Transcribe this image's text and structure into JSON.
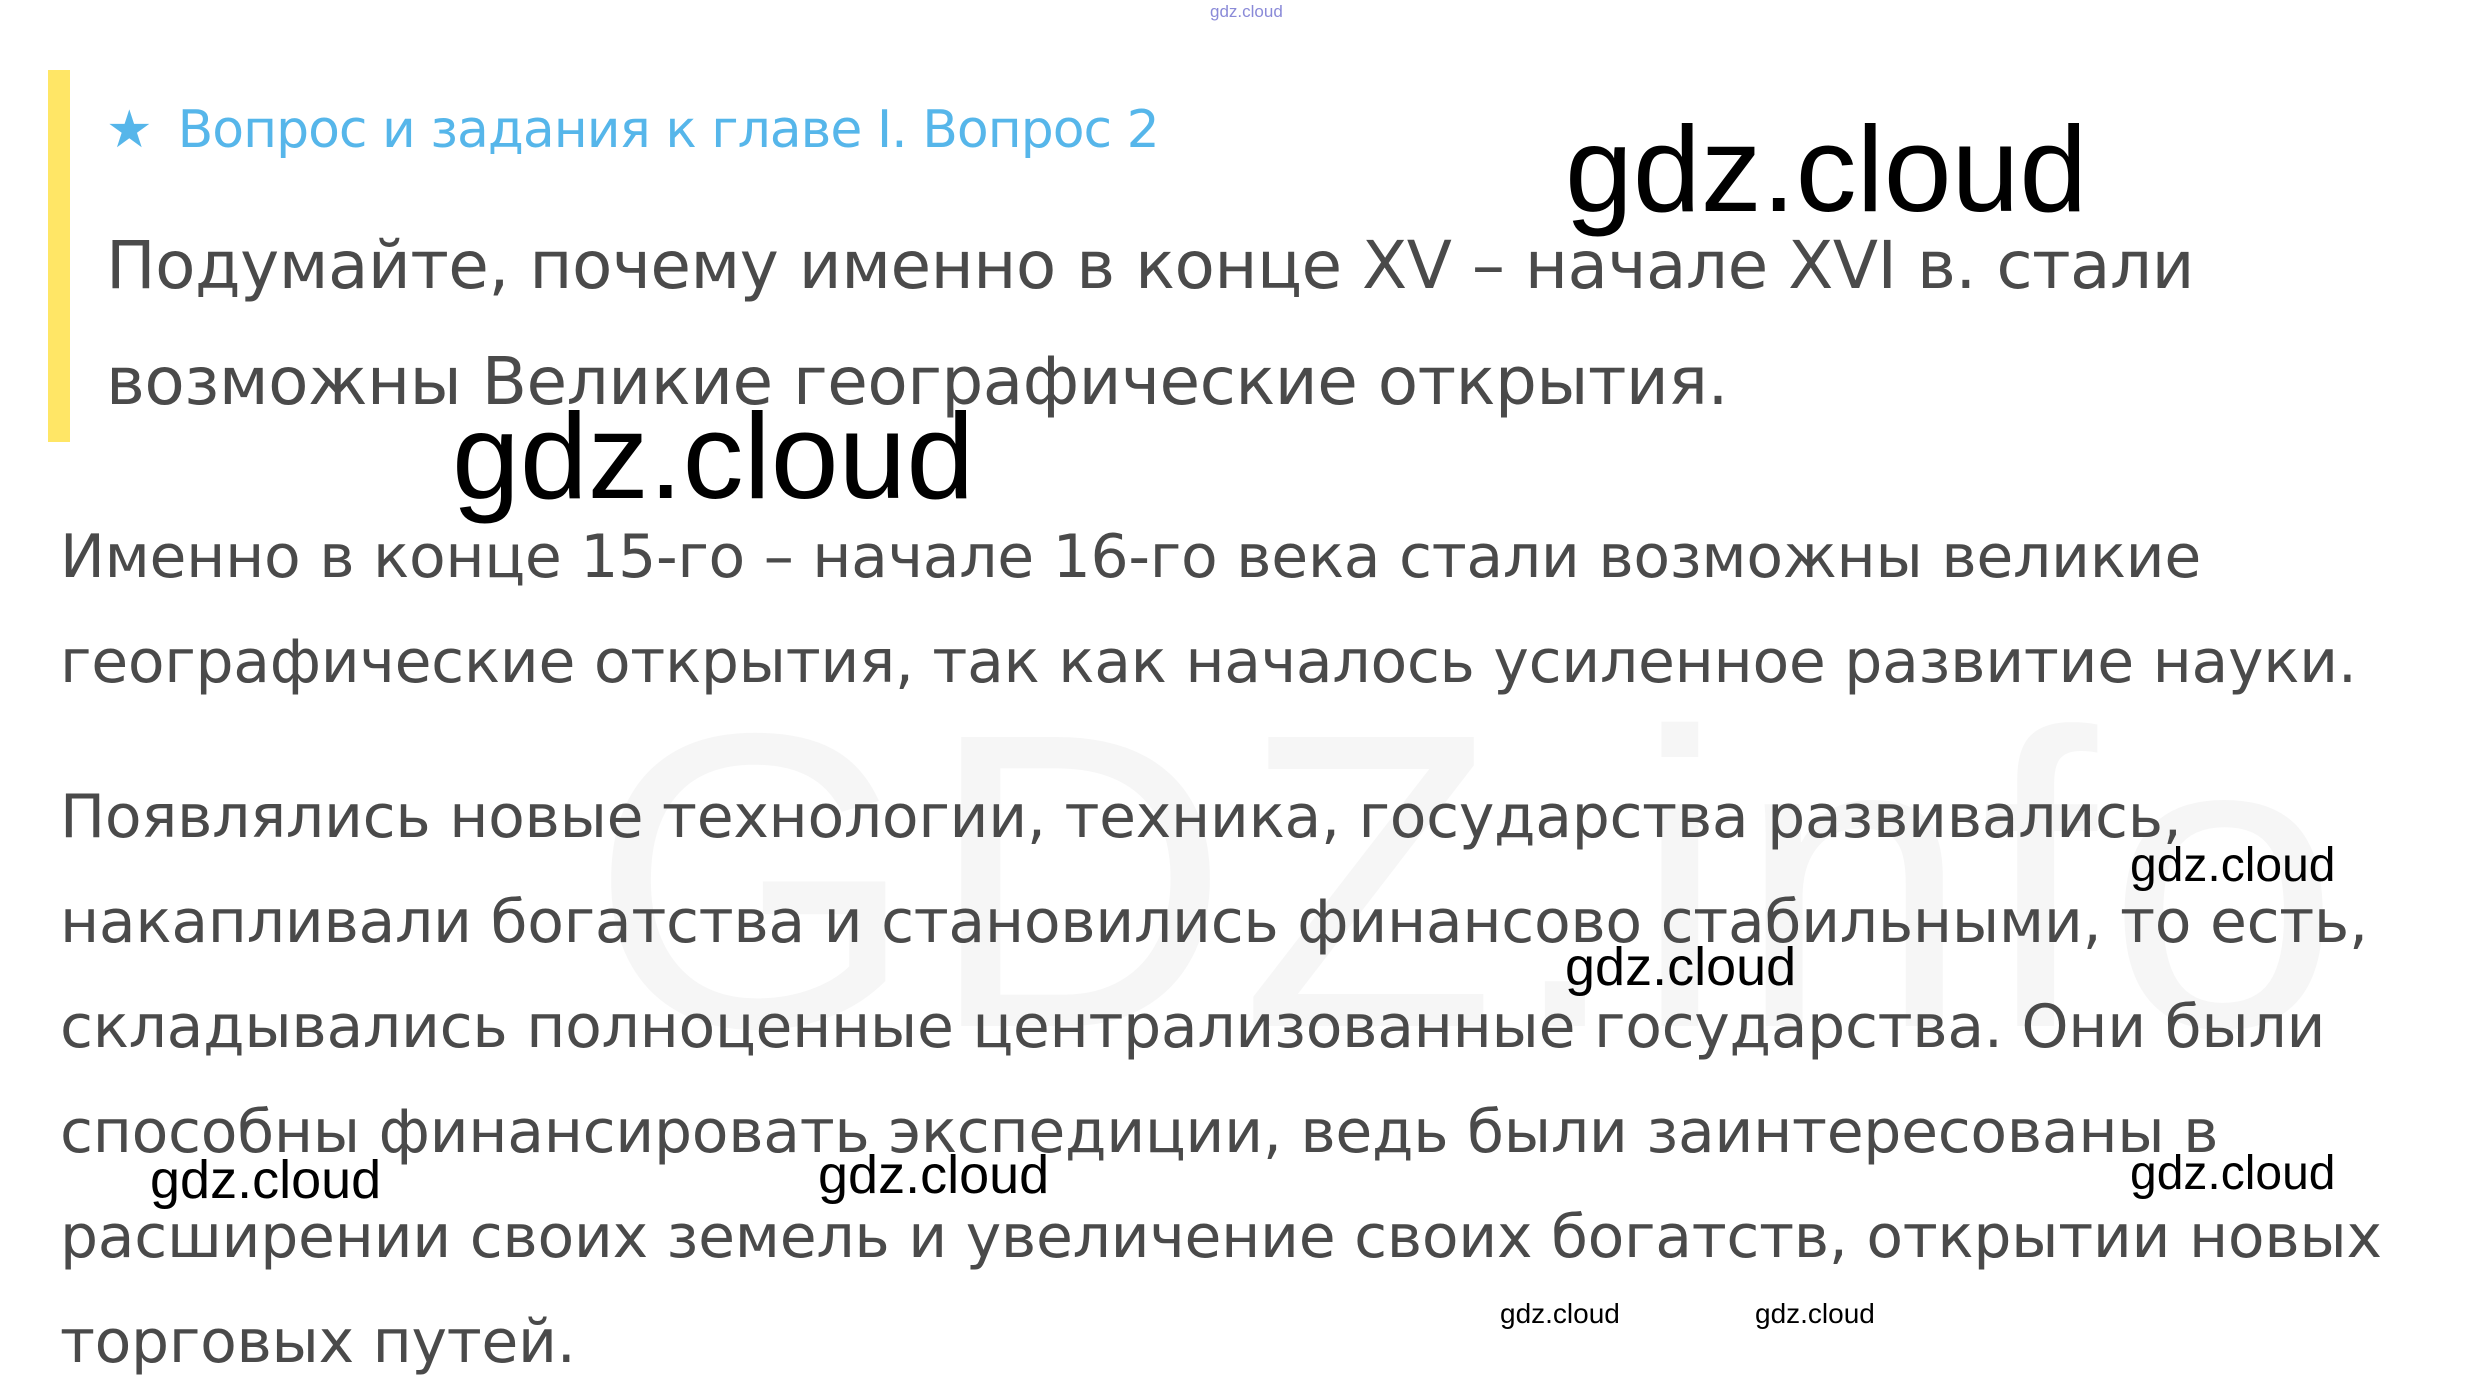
{
  "top_watermark": "gdz.cloud",
  "question": {
    "star_icon": "star-icon",
    "header": "Вопрос и задания к главе I. Вопрос 2",
    "text": "Подумайте, почему именно в конце XV – начале XVI в. стали возможны Великие географические открытия.",
    "accent_color": "#56b6ea",
    "bar_color": "#ffe666"
  },
  "answer": {
    "paragraph1": "Именно в конце 15-го – начале 16-го века стали возможны великие географические открытия, так как началось усиленное развитие науки.",
    "paragraph2": "Появлялись новые технологии, техника, государства развивались, накапливали богатства и становились финансово стабильными, то есть, складывались полноценные централизованные государства. Они были способны финансировать экспедиции, ведь были заинтересованы в расширении своих земель и увеличение своих богатств, открытии новых торговых путей."
  },
  "watermarks": {
    "large_top": "gdz.cloud",
    "large_mid": "gdz.cloud",
    "right_1": "gdz.cloud",
    "center_1": "gdz.cloud",
    "left_bottom": "gdz.cloud",
    "center_bottom": "gdz.cloud",
    "right_2": "gdz.cloud",
    "small_1": "gdz.cloud",
    "small_2": "gdz.cloud"
  },
  "background_watermark": "GDZ.info"
}
